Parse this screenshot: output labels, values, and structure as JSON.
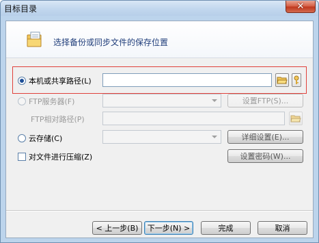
{
  "window": {
    "title": "目标目录",
    "close_glyph": "✕"
  },
  "header": {
    "text": "选择备份或同步文件的保存位置",
    "icon": "folder-document-icon"
  },
  "options": {
    "local_path": {
      "label": "本机或共享路径(L)",
      "value": "",
      "selected": true
    },
    "ftp_server": {
      "label": "FTP服务器(F)",
      "value": "",
      "button": "设置FTP(S)...",
      "selected": false,
      "disabled": true
    },
    "ftp_relative_path": {
      "label": "FTP相对路径(P)",
      "value": ""
    },
    "cloud_storage": {
      "label": "云存储(C)",
      "value": "",
      "button": "详细设置(E)...",
      "selected": false
    },
    "compress": {
      "label": "对文件进行压缩(Z)",
      "button": "设置密码(W)...",
      "checked": false
    }
  },
  "buttons": {
    "prev": "< 上一步(B)",
    "next": "下一步(N) >",
    "finish": "完成",
    "cancel": "取消"
  },
  "colors": {
    "title_bar": "#c2d7ee",
    "highlight_border": "#e0403a",
    "header_text": "#1f3d7a"
  }
}
